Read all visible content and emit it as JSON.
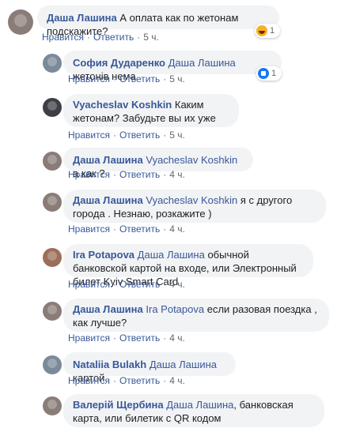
{
  "actions": {
    "like": "Нравится",
    "reply": "Ответить",
    "sep": "·"
  },
  "comments": [
    {
      "author": "Даша Лашина",
      "mention": "",
      "text": "А оплата как по жетонам подскажите?",
      "time": "5 ч.",
      "reaction_count": "1",
      "reaction": "haha-icon"
    },
    {
      "author": "София Дударенко",
      "mention": "Даша Лашина",
      "text": "жетонів нема",
      "time": "5 ч.",
      "reaction_count": "1",
      "reaction": "like-icon"
    },
    {
      "author": "Vyacheslav Koshkin",
      "mention": "",
      "text": "Каким жетонам? Забудьте вы их уже",
      "time": "5 ч."
    },
    {
      "author": "Даша Лашина",
      "mention": "Vyacheslav Koshkin",
      "text": "а как ?",
      "time": "4 ч."
    },
    {
      "author": "Даша Лашина",
      "mention": "Vyacheslav Koshkin",
      "text": "я с другого города . Незнаю, розкажите )",
      "time": "4 ч."
    },
    {
      "author": "Ira Potapova",
      "mention": "Даша Лашина",
      "text": "обычной банковской картой на входе, или Электронный билет Kyiv Smart Card",
      "time": "4 ч."
    },
    {
      "author": "Даша Лашина",
      "mention": "Ira Potapova",
      "text": "если разовая поездка , как лучше?",
      "time": "4 ч."
    },
    {
      "author": "Nataliia Bulakh",
      "mention": "Даша Лашина",
      "text": "картой",
      "time": "4 ч."
    },
    {
      "author": "Валерій Щербина",
      "mention": "Даша Лашина",
      "text": ", банковская карта, или билетик с QR кодом",
      "time": "4 ч."
    }
  ]
}
